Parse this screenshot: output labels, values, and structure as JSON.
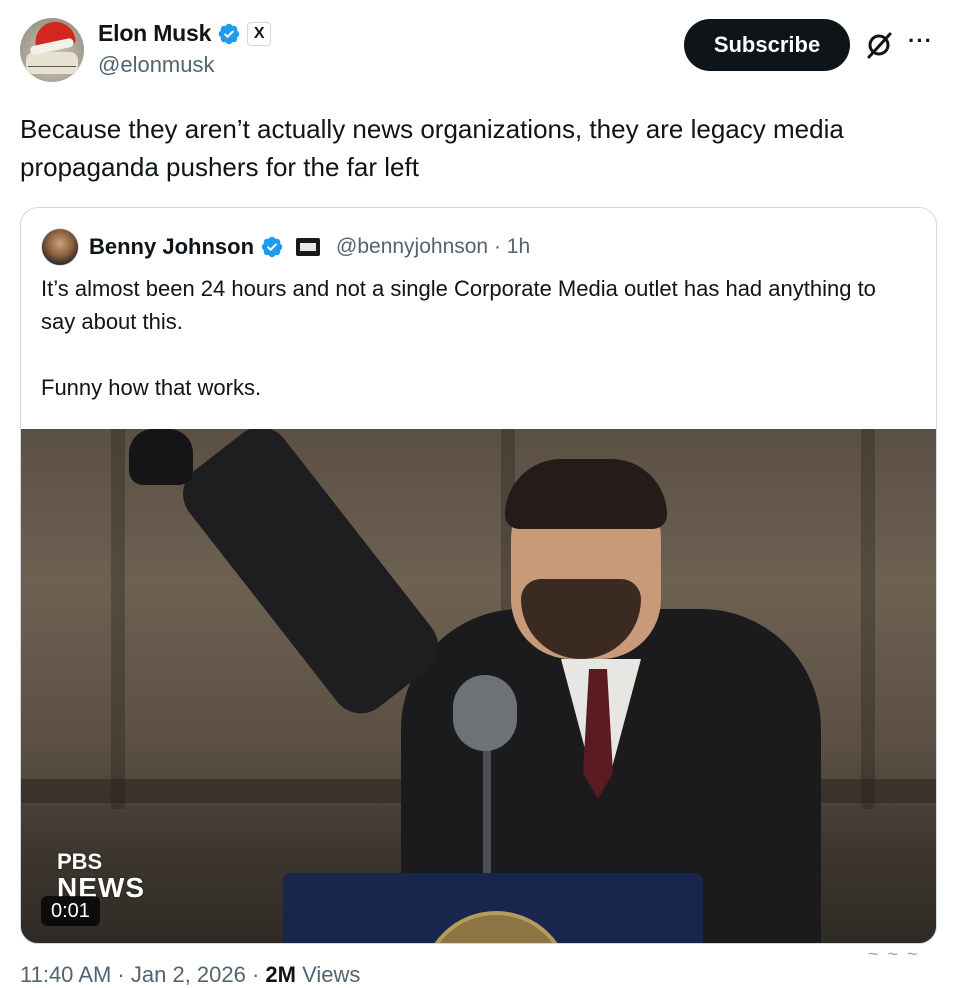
{
  "author": {
    "name": "Elon Musk",
    "handle": "@elonmusk",
    "verified_icon": "verified-badge-icon",
    "affiliation_badge": "X"
  },
  "actions": {
    "subscribe_label": "Subscribe",
    "grok_icon": "grok-icon",
    "more_label": "···"
  },
  "tweet": {
    "text": "Because they aren’t actually news organizations, they are legacy media propaganda pushers for the far left"
  },
  "quoted": {
    "name": "Benny Johnson",
    "handle_time": "@bennyjohnson · 1h",
    "text": "It’s almost been 24 hours and not a single Corporate Media outlet has had anything to say about this.\n\nFunny how that works.",
    "video": {
      "logo_top": "PBS",
      "logo_bottom": "NEWS",
      "duration": "0:01"
    }
  },
  "footer": {
    "time_date": "11:40 AM · Jan 2, 2026 · ",
    "views_count": "2M",
    "views_label": " Views"
  },
  "colors": {
    "text_primary": "#0f1419",
    "text_secondary": "#536471",
    "verified_blue": "#1d9bf0",
    "border": "#cfd9de"
  }
}
